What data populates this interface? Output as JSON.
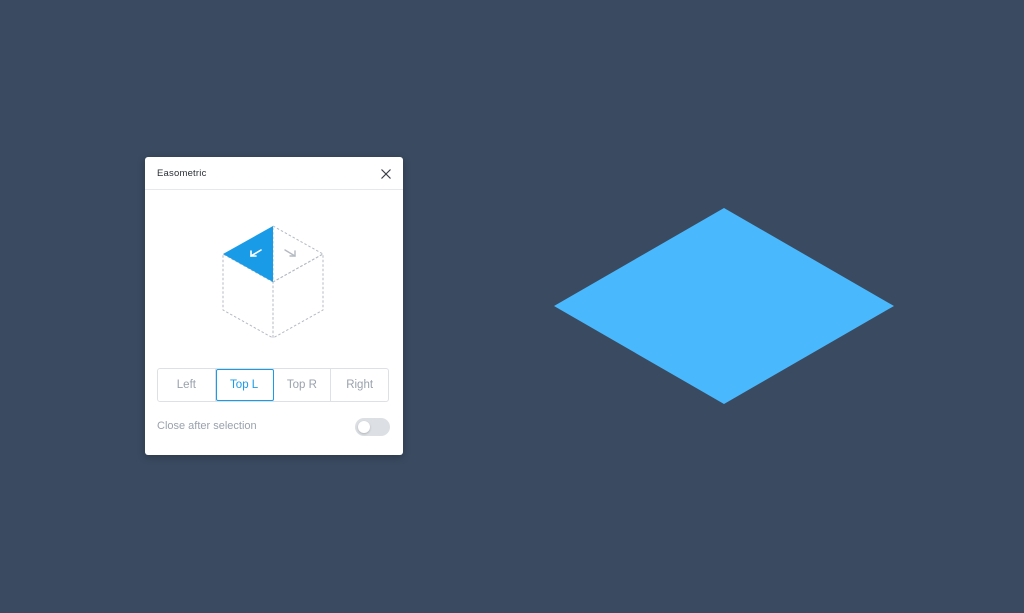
{
  "canvas": {
    "shape_color": "#4ab8fc",
    "background_color": "#3a4a60"
  },
  "panel": {
    "title": "Easometric",
    "close_icon": "close-icon",
    "cube": {
      "selected_face": "Top L",
      "active_color": "#1a9be8",
      "left_arrow_icon": "arrow-down-left-icon",
      "right_arrow_icon": "arrow-down-right-icon"
    },
    "options": [
      {
        "label": "Left",
        "active": false
      },
      {
        "label": "Top L",
        "active": true
      },
      {
        "label": "Top R",
        "active": false
      },
      {
        "label": "Right",
        "active": false
      }
    ],
    "close_after_selection": {
      "label": "Close after selection",
      "enabled": false
    }
  }
}
